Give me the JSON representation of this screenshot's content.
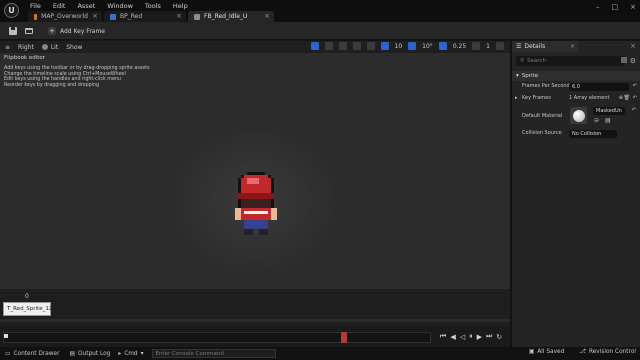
{
  "menu": [
    "File",
    "Edit",
    "Asset",
    "Window",
    "Tools",
    "Help"
  ],
  "tabs": [
    {
      "label": "MAP_Overworld",
      "icon_color": "#c87a2b"
    },
    {
      "label": "BP_Red",
      "icon_color": "#3b6fd1"
    },
    {
      "label": "FB_Red_Idle_U",
      "icon_color": "#8c8c8c"
    }
  ],
  "toolbar": {
    "add_key_frame": "Add Key Frame"
  },
  "viewport": {
    "view_mode": "Right",
    "lit_mode": "Lit",
    "show_label": "Show",
    "grid_size": "10",
    "angle_snap": "10°",
    "scale_snap": "0.25",
    "camera_speed": "1",
    "editor_title": "Flipbook editor",
    "hints": [
      "Add keys using the toolbar or by drag-dropping sprite assets",
      "Change the timeline scale using Ctrl+MouseWheel",
      "Edit keys using the handles and right-click menu",
      "Reorder keys by dragging and dropping"
    ]
  },
  "timeline": {
    "start_frame": "0",
    "frame_label": "T_Red_Sprite_12"
  },
  "details": {
    "tab_label": "Details",
    "search_placeholder": "Search",
    "section": "Sprite",
    "frames_per_second_label": "Frames Per Second",
    "frames_per_second_value": "6.0",
    "key_frames_label": "Key Frames",
    "key_frames_value": "1 Array element",
    "default_material_label": "Default Material",
    "default_material_value": "MaskedUn",
    "collision_source_label": "Collision Source",
    "collision_source_value": "No Collision"
  },
  "statusbar": {
    "content_drawer": "Content Drawer",
    "output_log": "Output Log",
    "cmd": "Cmd",
    "console_placeholder": "Enter Console Command",
    "all_saved": "All Saved",
    "revision_control": "Revision Control"
  },
  "colors": {
    "accent_blue": "#2b63c8",
    "scrub_handle": "#b03a3a",
    "sprite_red": "#c0282b"
  }
}
